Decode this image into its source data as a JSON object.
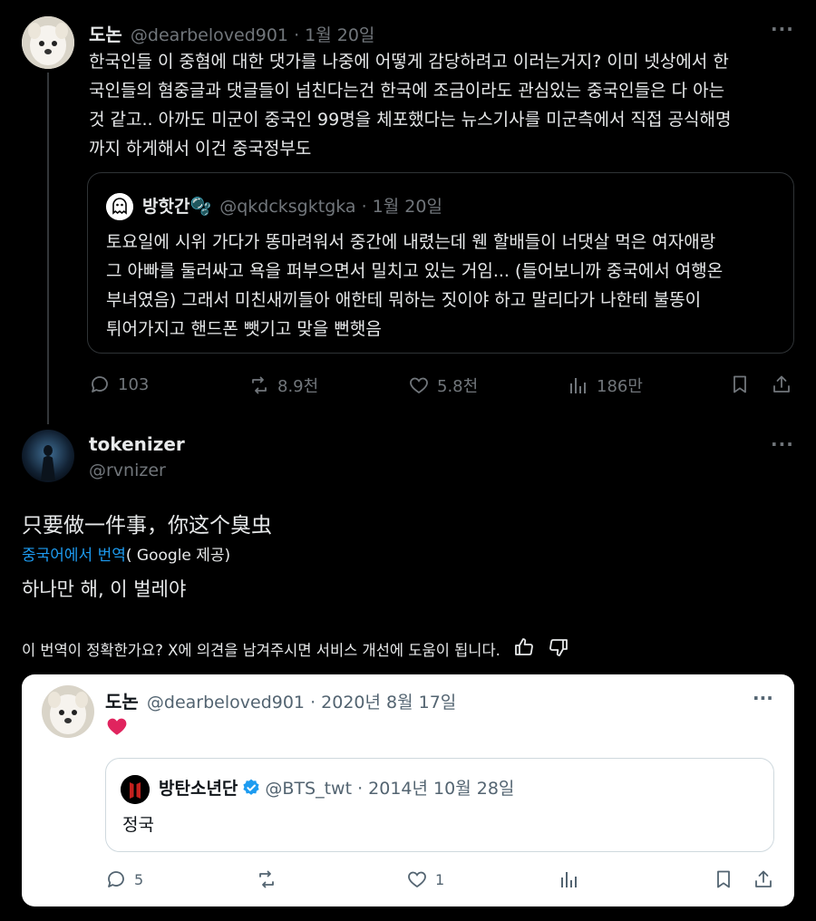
{
  "tweet1": {
    "name": "도논",
    "handle": "@dearbeloved901 · 1월 20일",
    "text_lines": [
      "한국인들 이 중혐에 대한 댓가를 나중에 어떻게 감당하려고 이러는거지? 이미 넷상에서 한",
      "국인들의 혐중글과 댓글들이 넘친다는건 한국에 조금이라도 관심있는 중국인들은 다 아는",
      "것 같고.. 아까도 미군이 중국인 99명을 체포했다는 뉴스기사를 미군측에서 직접 공식해명",
      "까지 하게해서 이건 중국정부도"
    ],
    "quote": {
      "name": "방핫간🫧",
      "handle": "@qkdcksgktgka · 1월 20일",
      "text_lines": [
        "토요일에 시위 가다가 똥마려워서 중간에 내렸는데 웬 할배들이 너댓살 먹은 여자애랑",
        "그 아빠를 둘러싸고 욕을 퍼부으면서 밀치고 있는 거임... (들어보니까 중국에서 여행온",
        "부녀였음) 그래서 미친새끼들아 애한테 뭐하는 짓이야 하고 말리다가 나한테 불똥이",
        "튀어가지고 핸드폰 뺏기고 맞을 뻔햇음"
      ]
    },
    "actions": {
      "replies": "103",
      "retweets": "8.9천",
      "likes": "5.8천",
      "views": "186만"
    }
  },
  "tweet2": {
    "name": "tokenizer",
    "handle": "@rvnizer",
    "text": "只要做一件事，你这个臭虫",
    "translate_link": "중국어에서 번역",
    "translate_provider": "( Google 제공)",
    "translation": "하나만 해, 이 벌레야",
    "feedback_prompt": "이 번역이 정확한가요? X에 의견을 남겨주시면 서비스 개선에 도움이 됩니다."
  },
  "embedded": {
    "name": "도논",
    "handle": "@dearbeloved901 · 2020년 8월 17일",
    "quote": {
      "name": "방탄소년단",
      "handle": "@BTS_twt · 2014년 10월 28일",
      "text": "정국"
    },
    "actions": {
      "replies": "5",
      "likes": "1"
    }
  },
  "colors": {
    "link": "#1d9bf0",
    "heart": "#e0245e",
    "verified": "#1d9bf0"
  }
}
